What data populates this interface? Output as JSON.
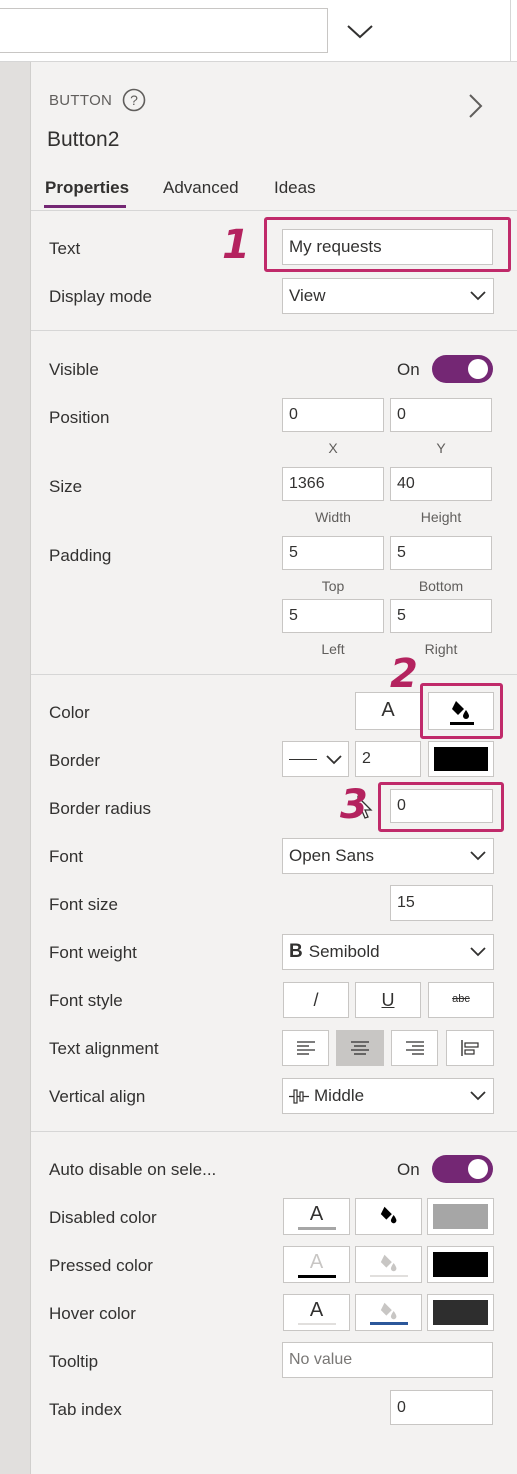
{
  "header": {
    "control_type": "BUTTON",
    "control_name": "Button2"
  },
  "tabs": [
    {
      "label": "Properties",
      "active": true
    },
    {
      "label": "Advanced",
      "active": false
    },
    {
      "label": "Ideas",
      "active": false
    }
  ],
  "props": {
    "text_label": "Text",
    "text_value": "My requests",
    "display_mode_label": "Display mode",
    "display_mode_value": "View",
    "visible_label": "Visible",
    "visible_state": "On",
    "position_label": "Position",
    "position_x": "0",
    "position_y": "0",
    "x_label": "X",
    "y_label": "Y",
    "size_label": "Size",
    "size_width": "1366",
    "size_height": "40",
    "width_label": "Width",
    "height_label": "Height",
    "padding_label": "Padding",
    "padding_top": "5",
    "padding_bottom": "5",
    "padding_left": "5",
    "padding_right": "5",
    "top_label": "Top",
    "bottom_label": "Bottom",
    "left_label": "Left",
    "right_label": "Right",
    "color_label": "Color",
    "color_text_glyph": "A",
    "border_label": "Border",
    "border_width": "2",
    "border_color": "#000000",
    "border_radius_label": "Border radius",
    "border_radius_value": "0",
    "font_label": "Font",
    "font_value": "Open Sans",
    "font_size_label": "Font size",
    "font_size_value": "15",
    "font_weight_label": "Font weight",
    "font_weight_glyph": "B",
    "font_weight_value": "Semibold",
    "font_style_label": "Font style",
    "italic_glyph": "/",
    "underline_glyph": "U",
    "strike_glyph": "abc",
    "text_alignment_label": "Text alignment",
    "vertical_align_label": "Vertical align",
    "vertical_align_value": "Middle",
    "auto_disable_label": "Auto disable on sele...",
    "auto_disable_state": "On",
    "disabled_color_label": "Disabled color",
    "disabled_fill": "#a6a6a6",
    "pressed_color_label": "Pressed color",
    "pressed_fill": "#000000",
    "hover_color_label": "Hover color",
    "hover_fill": "#2e2e2e",
    "tooltip_label": "Tooltip",
    "tooltip_placeholder": "No value",
    "tab_index_label": "Tab index",
    "tab_index_value": "0"
  },
  "annotations": {
    "one": "1",
    "two": "2",
    "three": "3"
  },
  "colors": {
    "accent": "#742774",
    "annotation": "#c02a6a"
  }
}
